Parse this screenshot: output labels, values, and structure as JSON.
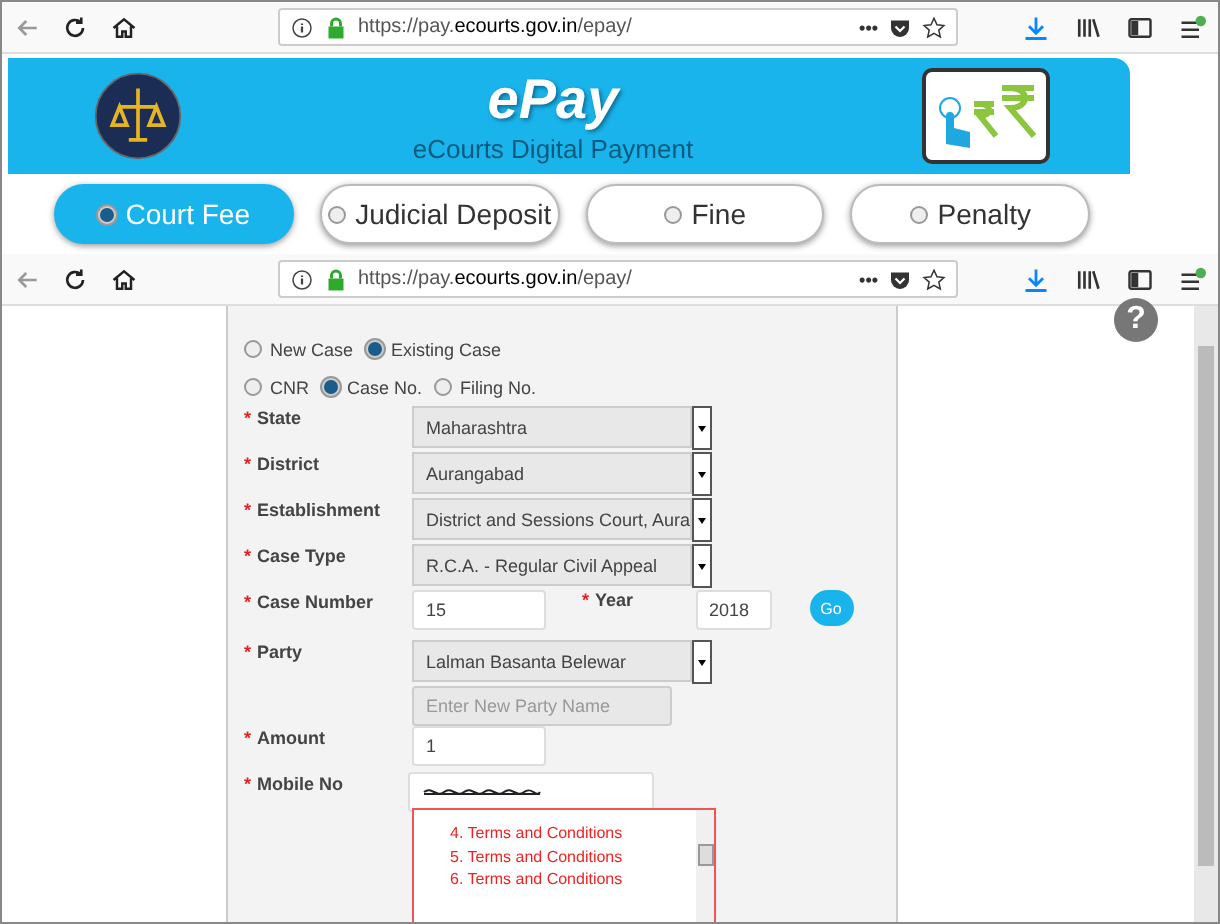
{
  "browser_bars": [
    {
      "url": "https://pay.**ecourts.gov.in**/epay/",
      "more": "•••"
    },
    {
      "url": "https://pay.**ecourts.gov.in**/epay/",
      "more": "•••"
    }
  ],
  "banner": {
    "title": "ePay",
    "subtitle": "eCourts Digital Payment"
  },
  "tabs": [
    {
      "label": "Court Fee",
      "selected": true
    },
    {
      "label": "Judicial Deposit",
      "selected": false
    },
    {
      "label": "Fine",
      "selected": false
    },
    {
      "label": "Penalty",
      "selected": false
    }
  ],
  "help": {
    "label": "?"
  },
  "case_options": [
    {
      "label": "New Case",
      "selected": false
    },
    {
      "label": "Existing Case",
      "selected": true
    }
  ],
  "search_by": [
    {
      "label": "CNR",
      "selected": false
    },
    {
      "label": "Case No.",
      "selected": true
    },
    {
      "label": "Filing No.",
      "selected": false
    }
  ],
  "rows": [
    {
      "kind": "select",
      "mark": "*",
      "label": "State",
      "value": "Maharashtra"
    },
    {
      "kind": "select",
      "mark": "*",
      "label": "District",
      "value": "Aurangabad"
    },
    {
      "kind": "select",
      "mark": "*",
      "label": "Establishment",
      "value": "District and Sessions Court, Aura"
    },
    {
      "kind": "select",
      "mark": "*",
      "label": "Case Type",
      "value": "R.C.A. - Regular Civil Appeal"
    },
    {
      "kind": "case_number",
      "mark": "*",
      "label": "Case Number",
      "value": "15",
      "year_mark": "*",
      "year_label": "Year",
      "year": "2018",
      "button": "Go"
    },
    {
      "kind": "select",
      "mark": "*",
      "label": "Party",
      "value": "Lalman Basanta Belewar"
    },
    {
      "kind": "placeholder",
      "placeholder": "Enter New Party Name"
    },
    {
      "kind": "text",
      "mark": "*",
      "label": "Amount",
      "value": "1"
    },
    {
      "kind": "masked",
      "mark": "*",
      "label": "Mobile No"
    },
    {
      "kind": "terms",
      "items": [
        "4. Terms and Conditions",
        "5. Terms and Conditions",
        "6. Terms and Conditions"
      ]
    }
  ]
}
